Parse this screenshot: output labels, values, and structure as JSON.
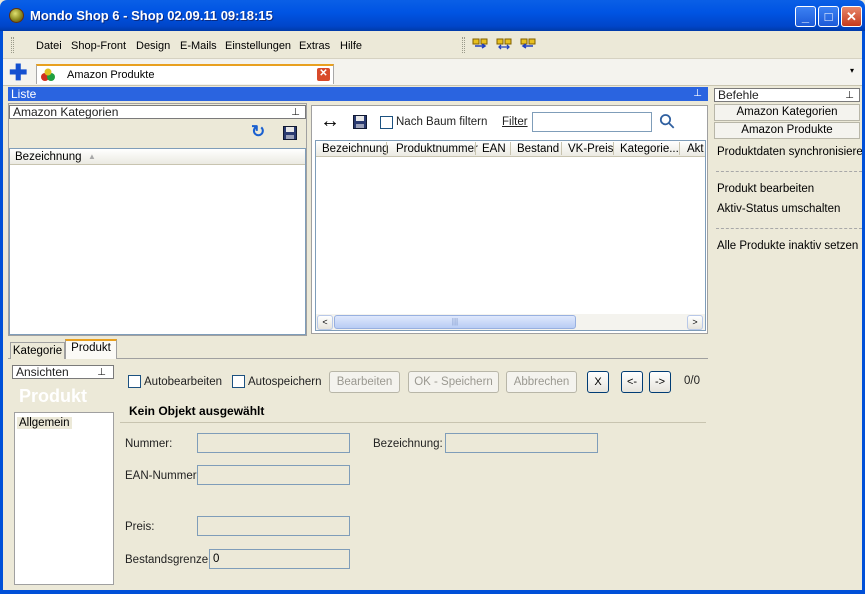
{
  "window": {
    "title": "Mondo Shop 6 - Shop 02.09.11 09:18:15",
    "minimize": "_",
    "maximize": "□",
    "close": "✕"
  },
  "menu": {
    "items": [
      "Datei",
      "Shop-Front",
      "Design",
      "E-Mails",
      "Einstellungen",
      "Extras",
      "Hilfe"
    ]
  },
  "toolbar": {
    "icons": [
      "import-icon",
      "sync-icon",
      "export-icon"
    ]
  },
  "tabs": {
    "add": "✚",
    "document_tab": "Amazon Produkte",
    "close": "✕",
    "dropdown": "▾"
  },
  "liste": {
    "title": "Liste",
    "pin": "⊥"
  },
  "kategorien": {
    "title": "Amazon Kategorien",
    "pin": "⊥",
    "refresh": "↻",
    "save": "💾",
    "column": "Bezeichnung",
    "sort_arrow": "▲"
  },
  "products": {
    "swap": "↔",
    "save": "💾",
    "filter_tree_label": "Nach Baum filtern",
    "filter_label": "Filter",
    "filter_value": "",
    "search": "⚲",
    "columns": [
      "Bezeichnung",
      "Produktnummer",
      "EAN",
      "Bestand",
      "VK-Preis",
      "Kategorie...",
      "Akt"
    ],
    "scroll_left": "<",
    "scroll_right": ">",
    "scroll_grip": "|||"
  },
  "bottom_tabs": [
    "Kategorie",
    "Produkt"
  ],
  "ansichten": {
    "title": "Ansichten",
    "pin": "⊥",
    "heading": "Produkt",
    "items": [
      "Allgemein"
    ]
  },
  "editor": {
    "autobearbeiten": "Autobearbeiten",
    "autospeichern": "Autospeichern",
    "bearbeiten": "Bearbeiten",
    "ok_speichern": "OK - Speichern",
    "abbrechen": "Abbrechen",
    "nav_delete": "X",
    "nav_prev": "<-",
    "nav_next": "->",
    "counter": "0/0",
    "status": "Kein Objekt ausgewählt",
    "fields": {
      "nummer": {
        "label": "Nummer:",
        "value": ""
      },
      "bezeichnung": {
        "label": "Bezeichnung:",
        "value": ""
      },
      "ean": {
        "label": "EAN-Nummer:",
        "value": ""
      },
      "preis": {
        "label": "Preis:",
        "value": ""
      },
      "bestandsgrenze": {
        "label": "Bestandsgrenze:",
        "value": "0"
      }
    }
  },
  "befehle": {
    "title": "Befehle",
    "pin": "⊥",
    "buttons": [
      "Amazon Kategorien",
      "Amazon Produkte"
    ],
    "commands": [
      "Produktdaten synchronisieren",
      "Produkt bearbeiten",
      "Aktiv-Status umschalten",
      "Alle Produkte inaktiv setzen"
    ]
  }
}
